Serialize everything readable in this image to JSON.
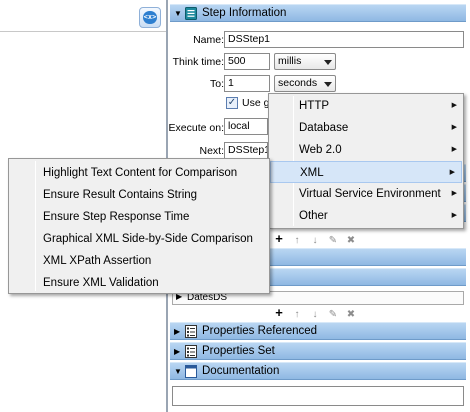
{
  "left_pane": {
    "xml_button_label": "<x>"
  },
  "step_info": {
    "section_label": "Step Information",
    "name_label": "Name:",
    "name_value": "DSStep1",
    "think_time_label": "Think time:",
    "think_time_value": "500",
    "think_time_unit": "millis",
    "to_label": "To:",
    "to_value": "1",
    "to_unit": "seconds",
    "use_checkbox_label": "Use g",
    "execute_on_label": "Execute on:",
    "execute_on_value": "local",
    "next_label": "Next:",
    "next_value": "DSStep1"
  },
  "datasets": {
    "item": "DatesDS"
  },
  "toolbar_glyphs": {
    "add": "+",
    "up": "↑",
    "down": "↓",
    "edit": "✎",
    "delete": "✖"
  },
  "sections": {
    "properties_referenced": "Properties Referenced",
    "properties_set": "Properties Set",
    "documentation": "Documentation"
  },
  "context_menu": {
    "items": [
      "HTTP",
      "Database",
      "Web 2.0",
      "XML",
      "Virtual Service Environment",
      "Other"
    ],
    "highlighted": "XML"
  },
  "xml_submenu": {
    "items": [
      "Highlight Text Content for Comparison",
      "Ensure Result Contains String",
      "Ensure Step Response Time",
      "Graphical XML Side-by-Side Comparison",
      "XML XPath Assertion",
      "Ensure XML Validation"
    ]
  },
  "colors": {
    "section_header": "#a6c8ec",
    "menu_bg": "#f0f0f0",
    "highlight": "#d6e6f8",
    "accent": "#2d7fd0"
  }
}
